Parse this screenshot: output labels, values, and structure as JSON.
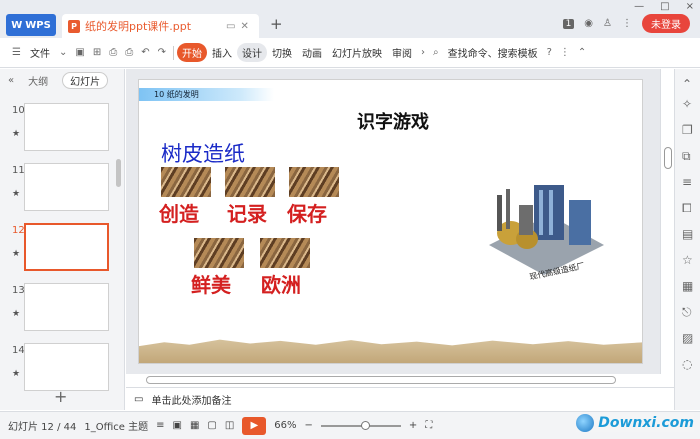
{
  "titlebar": {
    "wps_tab": "WPS",
    "doc_icon_letter": "P",
    "doc_tab": "纸的发明ppt课件.ppt",
    "page_badge": "1",
    "login": "未登录",
    "win_controls": [
      "—",
      "□",
      "×"
    ]
  },
  "menubar": {
    "file": "文件",
    "items": [
      "开始",
      "插入",
      "设计",
      "切换",
      "动画",
      "幻灯片放映",
      "审阅"
    ],
    "search": "查找命令、搜索模板"
  },
  "panel": {
    "tabs": [
      "大纲",
      "幻灯片"
    ],
    "slides": [
      {
        "num": "10"
      },
      {
        "num": "11"
      },
      {
        "num": "12"
      },
      {
        "num": "13"
      },
      {
        "num": "14"
      }
    ],
    "add": "+"
  },
  "slide": {
    "header": "10  纸的发明",
    "title": "识字游戏",
    "subtitle": "树皮造纸",
    "words_row1": [
      "创造",
      "记录",
      "保存"
    ],
    "words_row2": [
      "鲜美",
      "欧洲"
    ],
    "image_caption": "现代高级造纸厂"
  },
  "notes": {
    "placeholder": "单击此处添加备注"
  },
  "status": {
    "slide_info": "幻灯片 12 / 44",
    "theme": "1_Office 主题",
    "zoom": "66%",
    "zoom_level": 0.55
  },
  "watermark": "Downxi.com",
  "colors": {
    "accent": "#e8582b",
    "subtitle": "#1b2bc7",
    "word": "#d42020",
    "login": "#e8453c"
  }
}
